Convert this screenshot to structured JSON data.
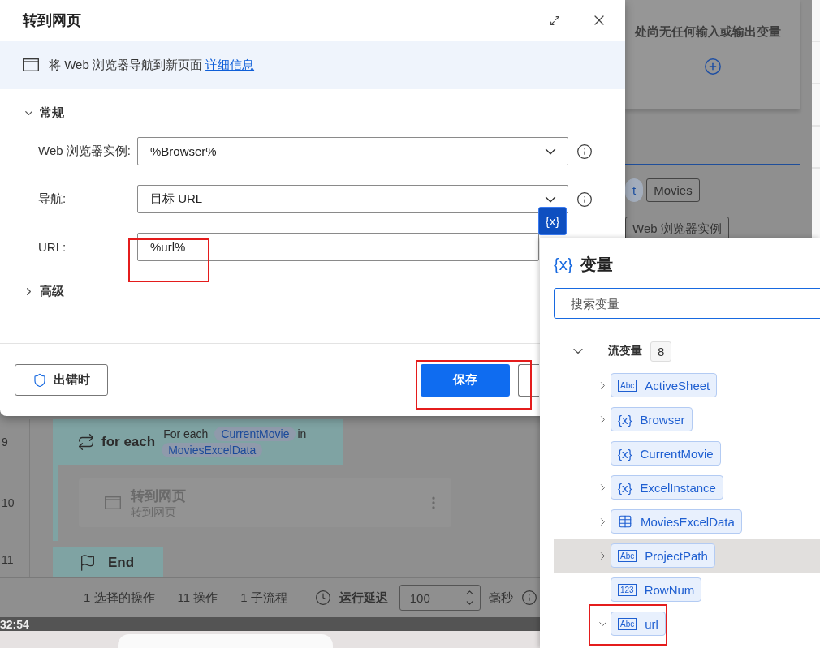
{
  "dialog": {
    "title": "转到网页",
    "description": "将 Web 浏览器导航到新页面",
    "link": "详细信息",
    "general": {
      "title": "常规",
      "expanded": true,
      "fields": [
        {
          "label": "Web 浏览器实例:",
          "value": "%Browser%",
          "kind": "dropdown"
        },
        {
          "label": "导航:",
          "value": "目标 URL",
          "kind": "dropdown"
        },
        {
          "label": "URL:",
          "value": "%url%",
          "kind": "text"
        }
      ]
    },
    "advanced": {
      "title": "高级",
      "expanded": false
    },
    "error_button": "出错时",
    "save_button": "保存"
  },
  "variable_button": "{x}",
  "variables_panel": {
    "icon": "{x}",
    "title": "变量",
    "search_placeholder": "搜索变量",
    "group": {
      "name": "流变量",
      "count": "8",
      "expanded": true,
      "items": [
        {
          "name": "ActiveSheet",
          "kind": "text",
          "badge": "Abc",
          "expandable": true,
          "expanded": false,
          "selected": false
        },
        {
          "name": "Browser",
          "kind": "object",
          "badge": "{x}",
          "expandable": true,
          "expanded": false,
          "selected": false
        },
        {
          "name": "CurrentMovie",
          "kind": "object",
          "badge": "{x}",
          "expandable": false,
          "selected": false
        },
        {
          "name": "ExcelInstance",
          "kind": "object",
          "badge": "{x}",
          "expandable": true,
          "expanded": false,
          "selected": false
        },
        {
          "name": "MoviesExcelData",
          "kind": "table",
          "expandable": true,
          "expanded": false,
          "selected": false
        },
        {
          "name": "ProjectPath",
          "kind": "text",
          "badge": "Abc",
          "expandable": true,
          "expanded": false,
          "selected": true
        },
        {
          "name": "RowNum",
          "kind": "number",
          "badge": "123",
          "expandable": false,
          "selected": false
        },
        {
          "name": "url",
          "kind": "text",
          "badge": "Abc",
          "expandable": true,
          "expanded": true,
          "selected": false
        }
      ]
    }
  },
  "io_panel": {
    "message": "处尚无任何输入或输出变量"
  },
  "param_rows": [
    [
      {
        "text": "t",
        "kind": "variable"
      },
      {
        "text": "Movies",
        "kind": "plain"
      }
    ],
    [
      {
        "text": "Web 浏览器实例",
        "kind": "plain"
      }
    ]
  ],
  "flow": {
    "steps": [
      {
        "line": "9",
        "kind": "loop",
        "title": "for each",
        "tokens": [
          {
            "text": "For each",
            "kind": "plain"
          },
          {
            "text": "CurrentMovie",
            "kind": "variable"
          },
          {
            "text": "in",
            "kind": "plain"
          },
          {
            "text": "MoviesExcelData",
            "kind": "variable"
          }
        ]
      },
      {
        "line": "10",
        "kind": "action",
        "title": "转到网页",
        "subtitle": "转到网页"
      },
      {
        "line": "11",
        "kind": "end",
        "title": "End"
      }
    ]
  },
  "status_bar": {
    "items": [
      "1 选择的操作",
      "11 操作",
      "1 子流程"
    ],
    "delay_label": "运行延迟",
    "delay_value": "100",
    "unit": "毫秒"
  },
  "clock": {
    "time": "32:54"
  }
}
